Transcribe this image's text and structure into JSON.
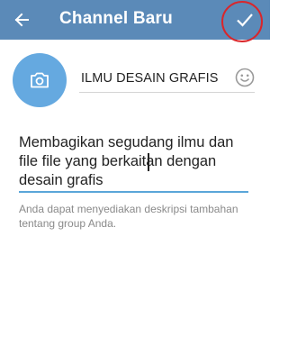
{
  "appbar": {
    "title": "Channel Baru",
    "back_icon": "arrow-left-icon",
    "confirm_icon": "check-icon",
    "background_color": "#5b8ab8"
  },
  "channel": {
    "photo_icon": "camera-icon",
    "name_value": "ILMU DESAIN GRAFIS",
    "emoji_icon": "smiley-icon",
    "description": "Membagikan segudang ilmu dan file file yang berkaitan dengan desain grafis",
    "helper_text": "Anda dapat menyediakan deskripsi tambahan tentang group Anda."
  },
  "annotation": {
    "highlight_color": "#d9262b"
  }
}
